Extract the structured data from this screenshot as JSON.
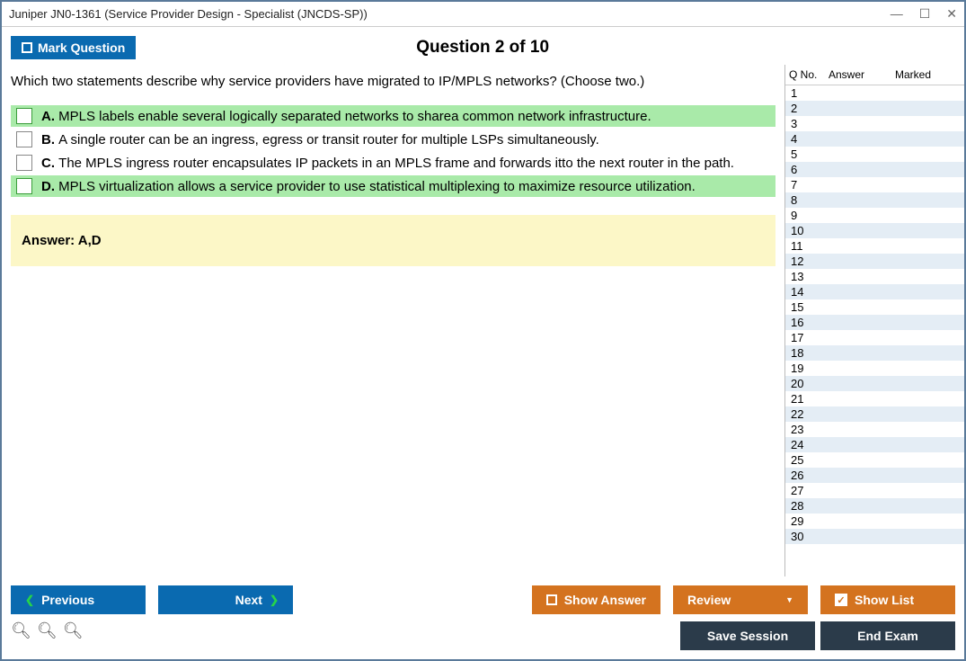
{
  "window": {
    "title": "Juniper JN0-1361 (Service Provider Design - Specialist (JNCDS-SP))"
  },
  "toolbar": {
    "mark_label": "Mark Question",
    "question_title": "Question 2 of 10"
  },
  "question": {
    "text": "Which two statements describe why service providers have migrated to IP/MPLS networks? (Choose two.)",
    "options": [
      {
        "letter": "A.",
        "text": "MPLS labels enable several logically separated networks to sharea common network infrastructure.",
        "highlighted": true
      },
      {
        "letter": "B.",
        "text": "A single router can be an ingress, egress or transit router for multiple LSPs simultaneously.",
        "highlighted": false
      },
      {
        "letter": "C.",
        "text": "The MPLS ingress router encapsulates IP packets in an MPLS frame and forwards itto the next router in the path.",
        "highlighted": false
      },
      {
        "letter": "D.",
        "text": "MPLS virtualization allows a service provider to use statistical multiplexing to maximize resource utilization.",
        "highlighted": true
      }
    ],
    "answer_label": "Answer: A,D"
  },
  "sidebar": {
    "h1": "Q No.",
    "h2": "Answer",
    "h3": "Marked",
    "rows": [
      1,
      2,
      3,
      4,
      5,
      6,
      7,
      8,
      9,
      10,
      11,
      12,
      13,
      14,
      15,
      16,
      17,
      18,
      19,
      20,
      21,
      22,
      23,
      24,
      25,
      26,
      27,
      28,
      29,
      30
    ]
  },
  "buttons": {
    "previous": "Previous",
    "next": "Next",
    "show_answer": "Show Answer",
    "review": "Review",
    "show_list": "Show List",
    "save_session": "Save Session",
    "end_exam": "End Exam"
  }
}
